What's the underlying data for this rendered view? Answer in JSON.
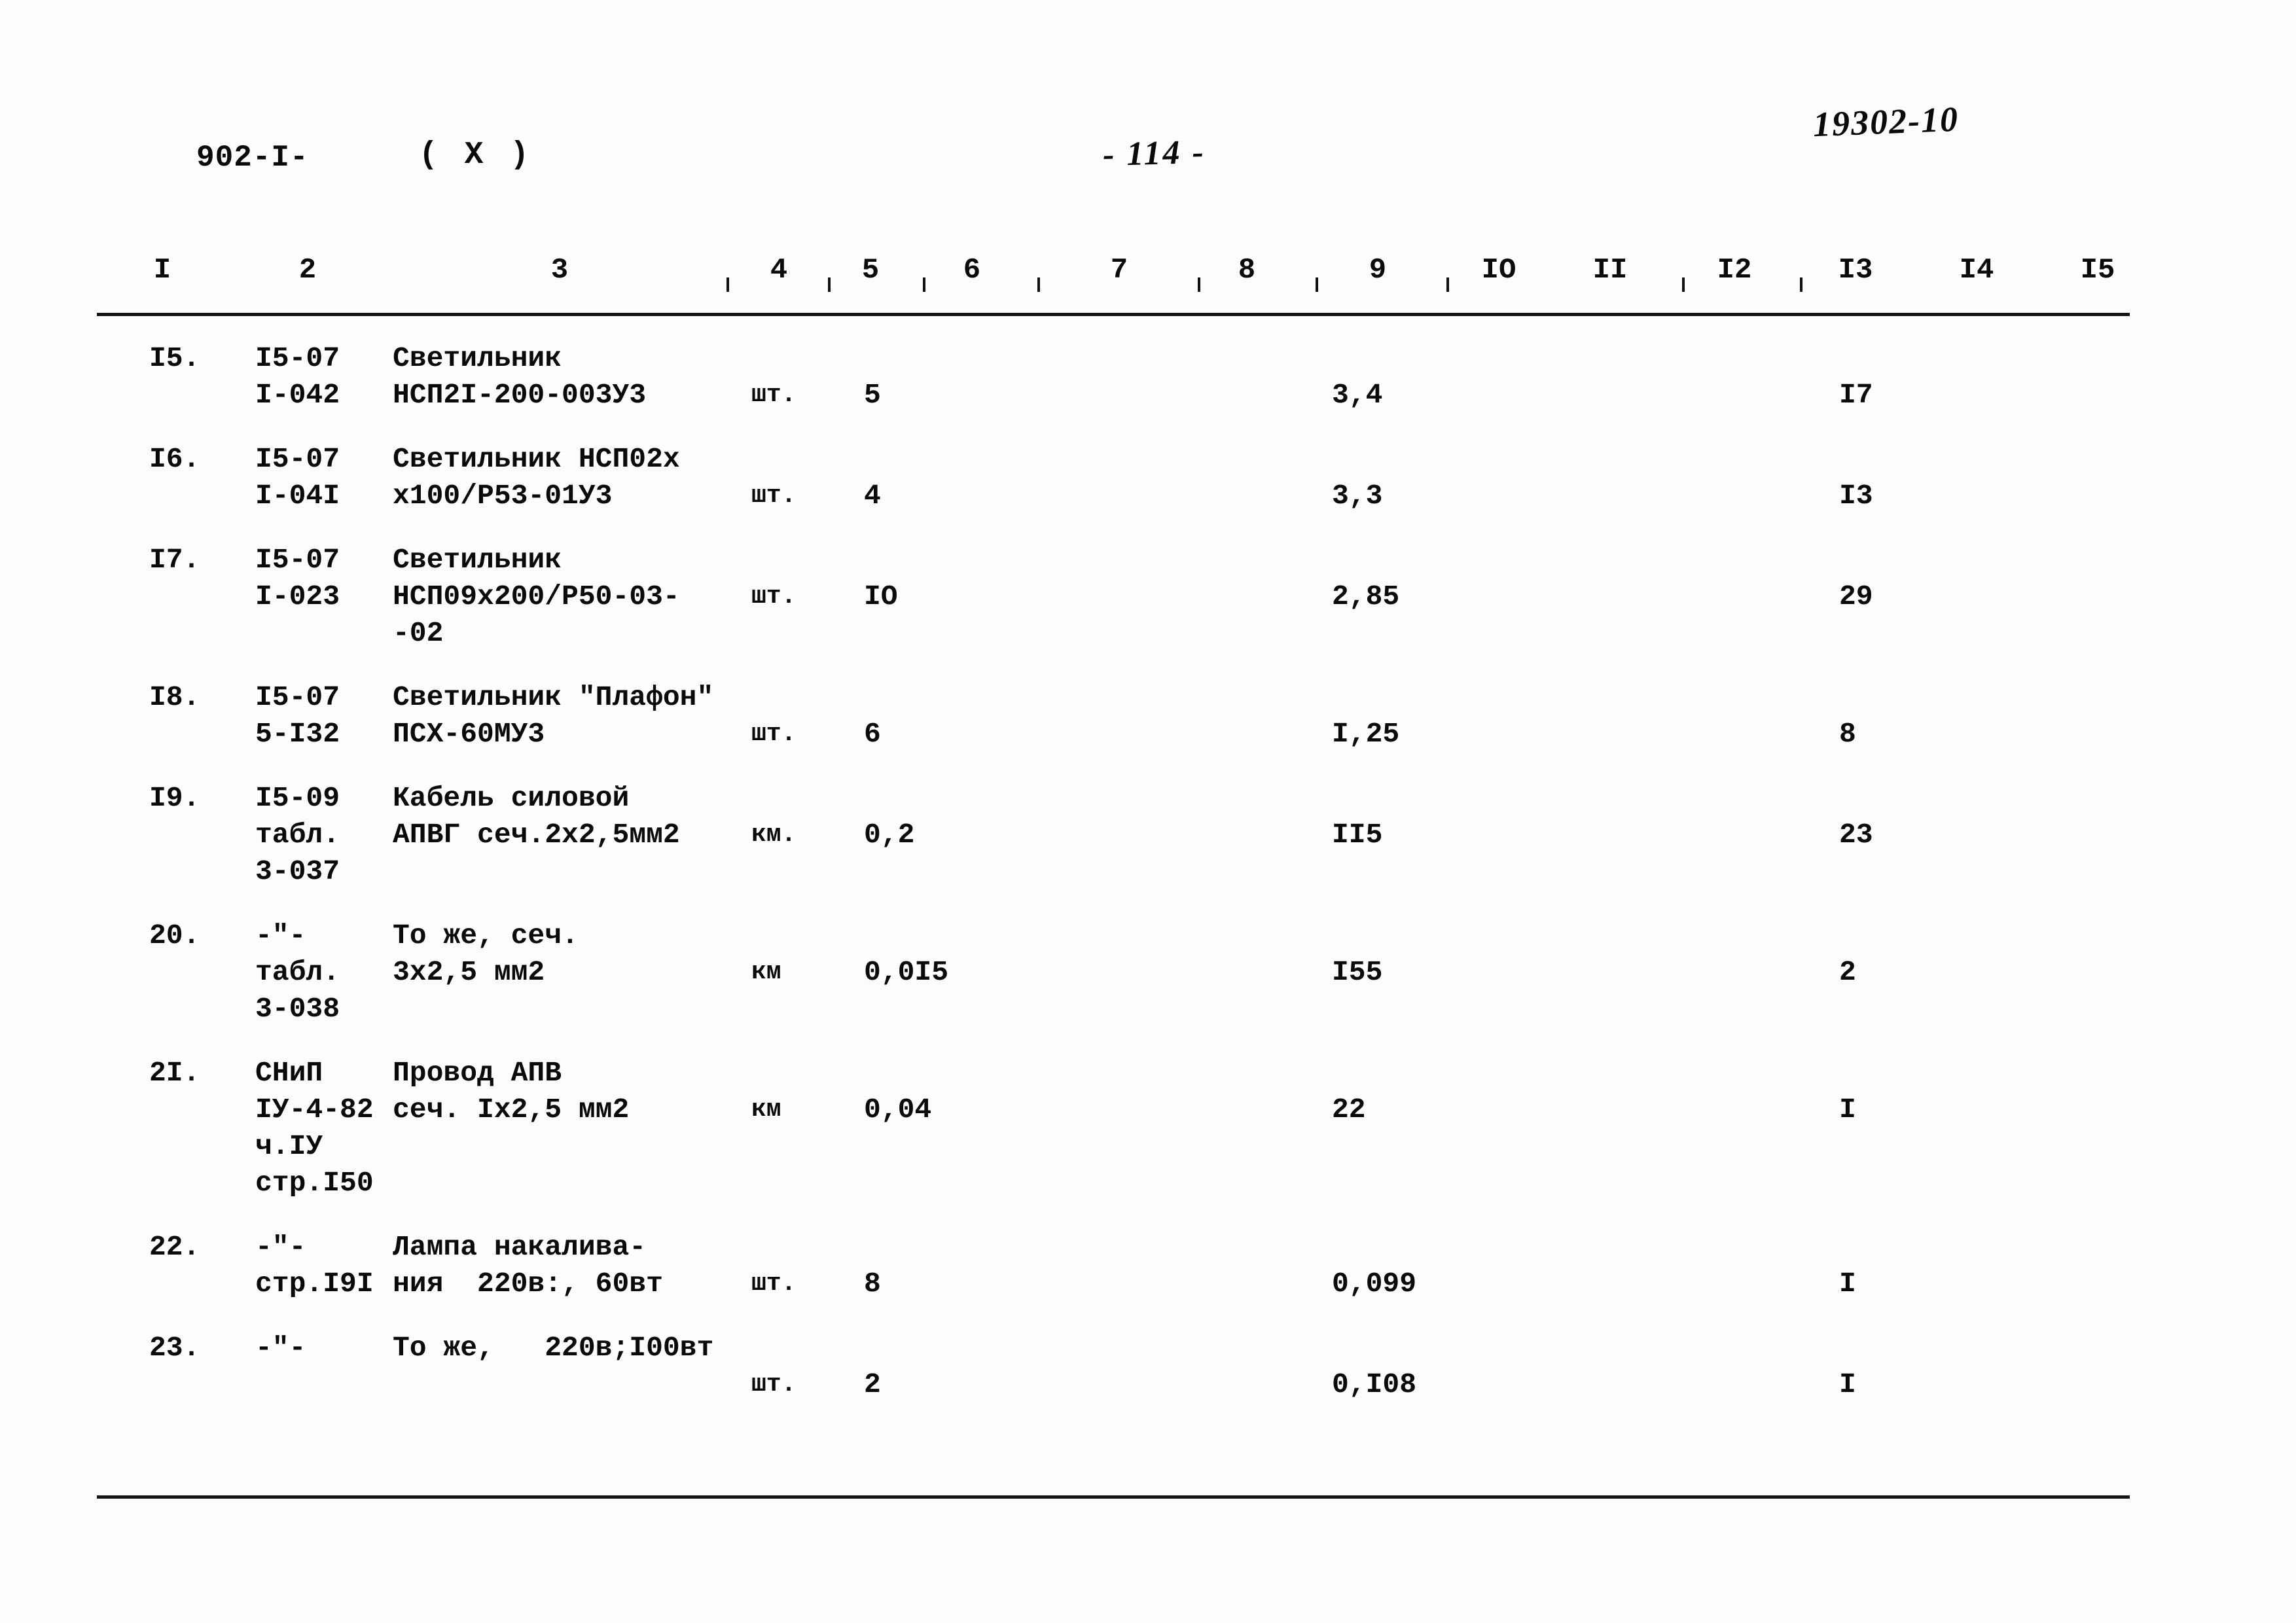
{
  "header": {
    "doc_code": "902-I-",
    "variant_mark": "( Х )",
    "page_number": "- 114 -",
    "sheet_code": "19302-10"
  },
  "column_numbers": [
    "I",
    "2",
    "3",
    "4",
    "5",
    "6",
    "7",
    "8",
    "9",
    "IO",
    "II",
    "I2",
    "I3",
    "I4",
    "I5"
  ],
  "rows": [
    {
      "num": "I5.",
      "code": "I5-07\nI-042",
      "name": "Светильник\nНСП2I-200-003У3",
      "unit": "шт.",
      "qty": "5",
      "price": "3,4",
      "sum": "I7"
    },
    {
      "num": "I6.",
      "code": "I5-07\nI-04I",
      "name": "Светильник НСП02х\nх100/Р53-01У3",
      "unit": "шт.",
      "qty": "4",
      "price": "3,3",
      "sum": "I3"
    },
    {
      "num": "I7.",
      "code": "I5-07\nI-023",
      "name": "Светильник\nНСП09х200/Р50-03-\n-02",
      "unit": "шт.",
      "qty": "IO",
      "price": "2,85",
      "sum": "29"
    },
    {
      "num": "I8.",
      "code": "I5-07\n5-I32",
      "name": "Светильник \"Плафон\"\nПСХ-60МУ3",
      "unit": "шт.",
      "qty": "6",
      "price": "I,25",
      "sum": "8"
    },
    {
      "num": "I9.",
      "code": "I5-09\nтабл.\n3-037",
      "name": "Кабель силовой\nАПВГ сеч.2х2,5мм2",
      "unit": "км.",
      "qty": "0,2",
      "price": "II5",
      "sum": "23"
    },
    {
      "num": "20.",
      "code": "-\"-\nтабл.\n3-038",
      "name": "То же, сеч.\n3х2,5 мм2",
      "unit": "км",
      "qty": "0,0I5",
      "price": "I55",
      "sum": "2"
    },
    {
      "num": "2I.",
      "code": "СНиП\nIУ-4-82\nч.IУ\nстр.I50",
      "name": "Провод АПВ\nсеч. Iх2,5 мм2",
      "unit": "км",
      "qty": "0,04",
      "price": "22",
      "sum": "I"
    },
    {
      "num": "22.",
      "code": "-\"-\nстр.I9I",
      "name": "Лампа накалива-\nния  220в:, 60вт",
      "unit": "шт.",
      "qty": "8",
      "price": "0,099",
      "sum": "I"
    },
    {
      "num": "23.",
      "code": "-\"-",
      "name": "То же,   220в;I00вт",
      "unit": "шт.",
      "qty": "2",
      "price": "0,I08",
      "sum": "I"
    }
  ]
}
